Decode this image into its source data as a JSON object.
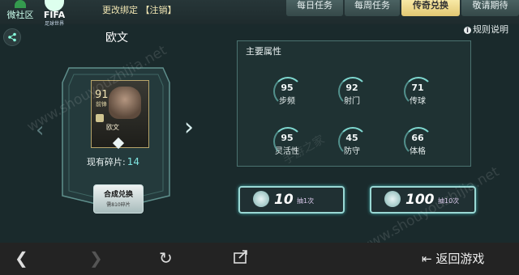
{
  "topbar": {
    "community_label": "微社区",
    "fifa_logo": "FIFA",
    "fifa_sub": "足球世界",
    "rebind_text": "更改绑定 【注销】",
    "tabs": [
      "每日任务",
      "每周任务",
      "传奇兑换",
      "敬请期待"
    ],
    "active_tab": "传奇兑换"
  },
  "rules_label": "规则说明",
  "player": {
    "name": "欧文",
    "card_rating": "91",
    "card_pos": "前锋",
    "card_name": "欧文",
    "shards_label": "现有碎片:",
    "shards_value": "14",
    "synth_label": "合成兑换",
    "synth_need": "需810碎片"
  },
  "attributes": {
    "title": "主要属性",
    "stats": [
      {
        "label": "步频",
        "value": "95"
      },
      {
        "label": "射门",
        "value": "92"
      },
      {
        "label": "传球",
        "value": "71"
      },
      {
        "label": "灵活性",
        "value": "95"
      },
      {
        "label": "防守",
        "value": "45"
      },
      {
        "label": "体格",
        "value": "66"
      }
    ]
  },
  "draws": [
    {
      "count": "10",
      "label": "抽1次"
    },
    {
      "count": "100",
      "label": "抽10次"
    }
  ],
  "watermark": "www.shouyouzhijia.net",
  "watermark_cn": "手游之家",
  "bottom": {
    "return_label": "返回游戏"
  },
  "colors": {
    "accent": "#7fe3e0",
    "gold_tab": "#f0d888"
  }
}
